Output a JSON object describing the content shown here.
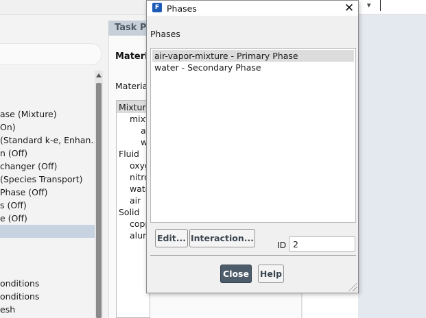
{
  "left_tree": {
    "items": [
      {
        "label": "ase (Mixture)"
      },
      {
        "label": "On)"
      },
      {
        "label": "(Standard k-e, Enhan..."
      },
      {
        "label": "n (Off)"
      },
      {
        "label": "changer (Off)"
      },
      {
        "label": "(Species Transport)"
      },
      {
        "label": " Phase (Off)"
      },
      {
        "label": "s (Off)"
      },
      {
        "label": "e (Off)"
      },
      {
        "label": ""
      },
      {
        "label": "onditions"
      },
      {
        "label": "onditions"
      },
      {
        "label": "esh"
      }
    ]
  },
  "task_page": {
    "title": "Task Pa",
    "heading": "Materia",
    "materials_label": "Material",
    "materials_list": [
      "Mixture",
      "mixt",
      "ai",
      "w",
      "Fluid",
      "oxyg",
      "nitro",
      "wate",
      "air",
      "Solid",
      "copp",
      "alum"
    ]
  },
  "dialog": {
    "title": "Phases",
    "app_icon_letter": "F",
    "close_glyph": "✕",
    "phases_label": "Phases",
    "phases": [
      {
        "label": "air-vapor-mixture - Primary Phase",
        "selected": true
      },
      {
        "label": "water - Secondary Phase",
        "selected": false
      }
    ],
    "edit_label": "Edit...",
    "interaction_label": "Interaction...",
    "id_label": "ID",
    "id_value": "2",
    "close_label": "Close",
    "help_label": "Help"
  },
  "colors": {
    "selection": "#dcdcdc",
    "tree_selection": "#c7d3e1",
    "primary_button": "#4d5c6b",
    "task_header": "#c7cfd8"
  }
}
